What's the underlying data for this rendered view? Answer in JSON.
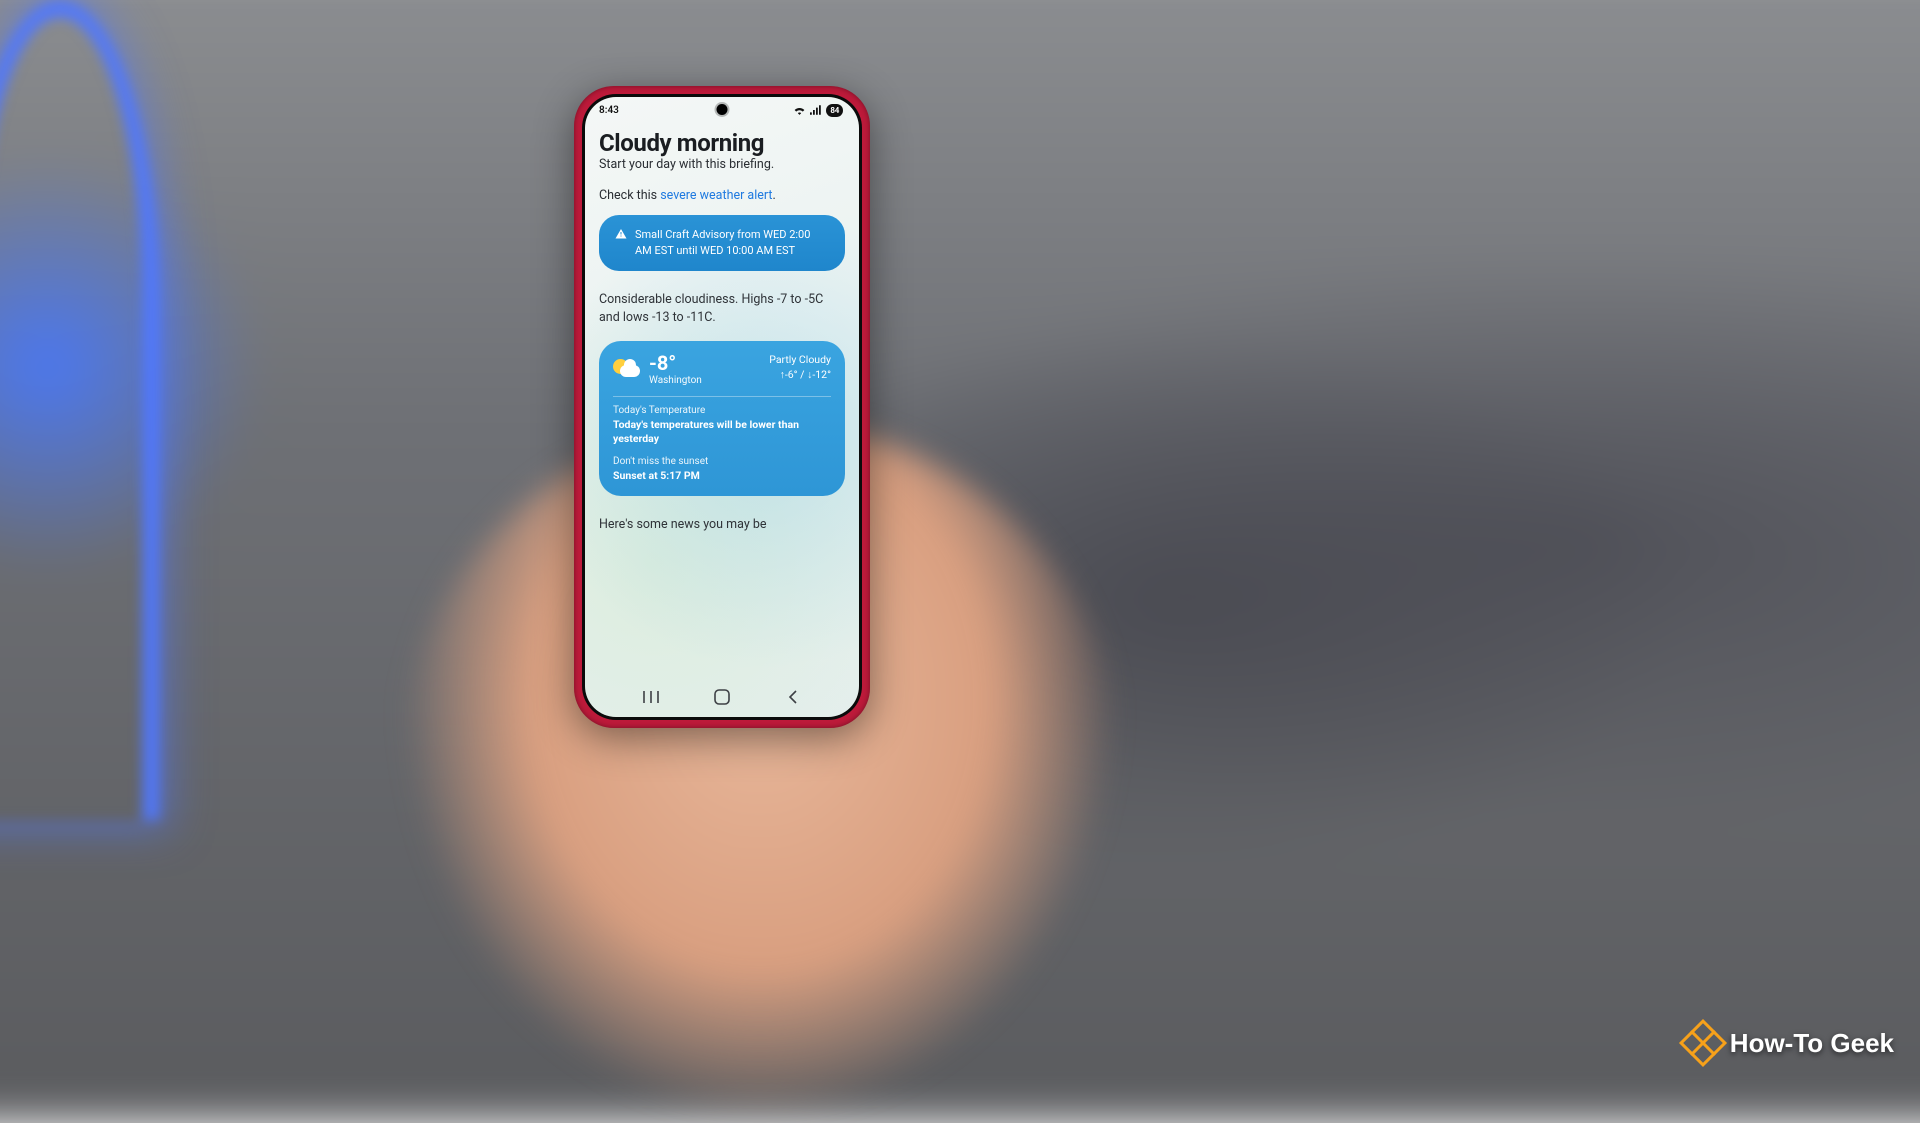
{
  "status": {
    "time": "8:43",
    "battery": "84"
  },
  "briefing": {
    "title": "Cloudy morning",
    "subtitle": "Start your day with this briefing.",
    "alert_prefix": "Check this ",
    "alert_link": "severe weather alert",
    "alert_suffix": "."
  },
  "advisory": {
    "text": "Small Craft Advisory from WED 2:00 AM EST until WED 10:00 AM EST"
  },
  "forecast": {
    "text": "Considerable cloudiness. Highs -7 to -5C and lows -13 to -11C."
  },
  "weather": {
    "temp": "-8°",
    "location": "Washington",
    "condition": "Partly Cloudy",
    "hilo": "↑-6° / ↓-12°",
    "today_label": "Today's Temperature",
    "today_text": "Today's temperatures will be lower than yesterday",
    "sunset_label": "Don't miss the sunset",
    "sunset_text": "Sunset at 5:17 PM"
  },
  "news": {
    "intro": "Here's some news you may be"
  },
  "watermark": {
    "text": "How-To Geek"
  }
}
